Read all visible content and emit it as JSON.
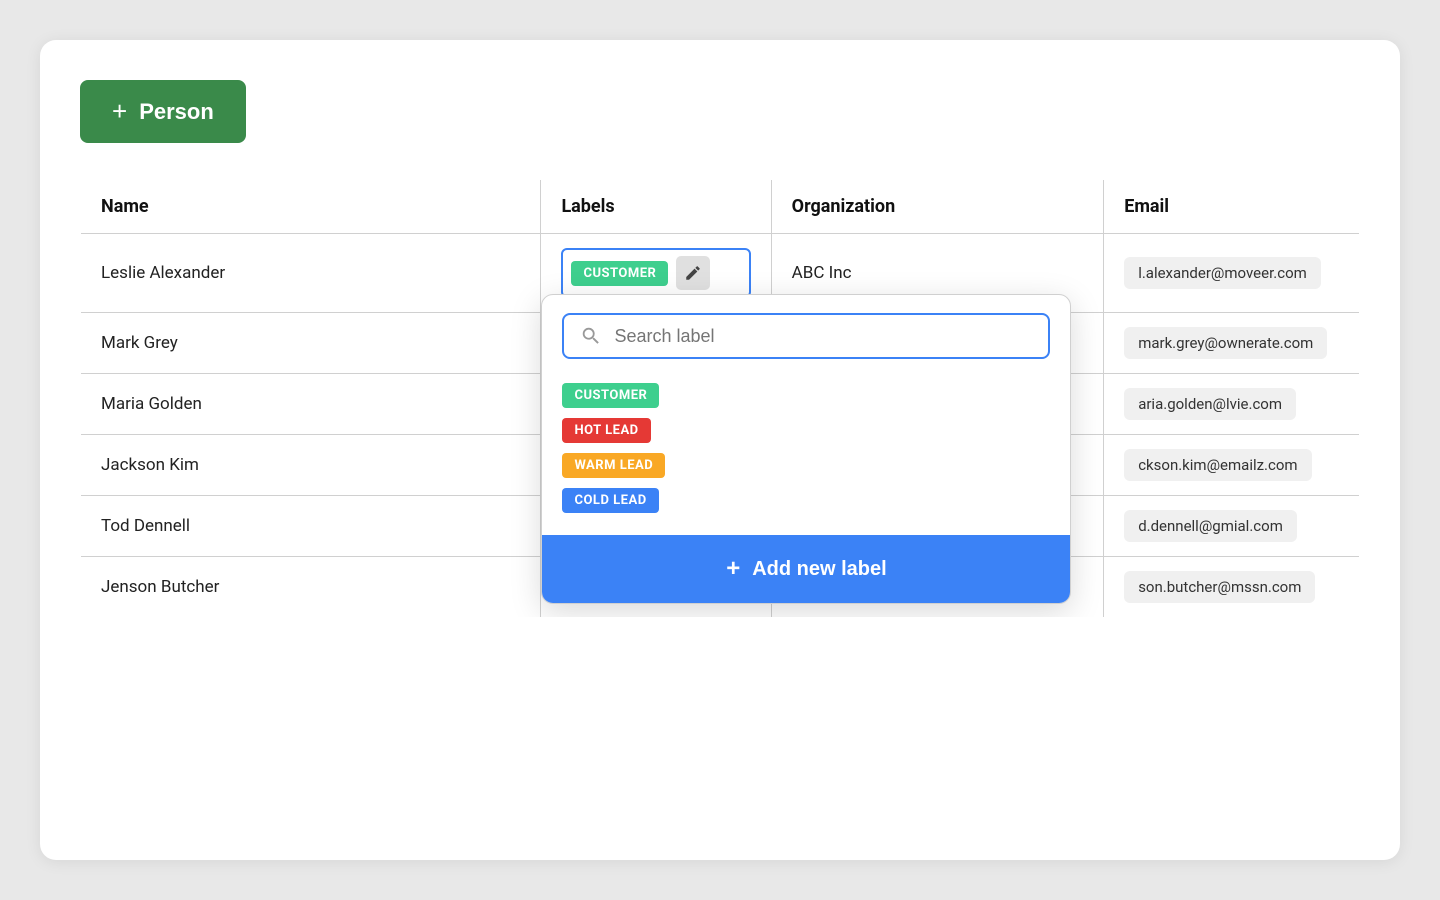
{
  "addButton": {
    "label": "Person",
    "plus": "+"
  },
  "table": {
    "headers": [
      "Name",
      "Labels",
      "Organization",
      "Email"
    ],
    "rows": [
      {
        "name": "Leslie Alexander",
        "label": "CUSTOMER",
        "labelClass": "customer",
        "org": "ABC Inc",
        "email": "l.alexander@moveer.com",
        "hasDropdown": true
      },
      {
        "name": "Mark Grey",
        "label": "",
        "labelClass": "",
        "org": "",
        "email": "mark.grey@ownerate.com",
        "hasDropdown": false
      },
      {
        "name": "Maria Golden",
        "label": "",
        "labelClass": "",
        "org": "",
        "email": "aria.golden@lvie.com",
        "hasDropdown": false
      },
      {
        "name": "Jackson Kim",
        "label": "",
        "labelClass": "",
        "org": "",
        "email": "ckson.kim@emailz.com",
        "hasDropdown": false
      },
      {
        "name": "Tod Dennell",
        "label": "",
        "labelClass": "",
        "org": "",
        "email": "d.dennell@gmial.com",
        "hasDropdown": false
      },
      {
        "name": "Jenson Butcher",
        "label": "",
        "labelClass": "",
        "org": "",
        "email": "son.butcher@mssn.com",
        "hasDropdown": false
      }
    ]
  },
  "dropdown": {
    "searchPlaceholder": "Search label",
    "labels": [
      {
        "text": "CUSTOMER",
        "class": "customer"
      },
      {
        "text": "HOT LEAD",
        "class": "hot-lead"
      },
      {
        "text": "WARM LEAD",
        "class": "warm-lead"
      },
      {
        "text": "COLD LEAD",
        "class": "cold-lead"
      }
    ],
    "addLabel": "Add new label",
    "plus": "+"
  }
}
